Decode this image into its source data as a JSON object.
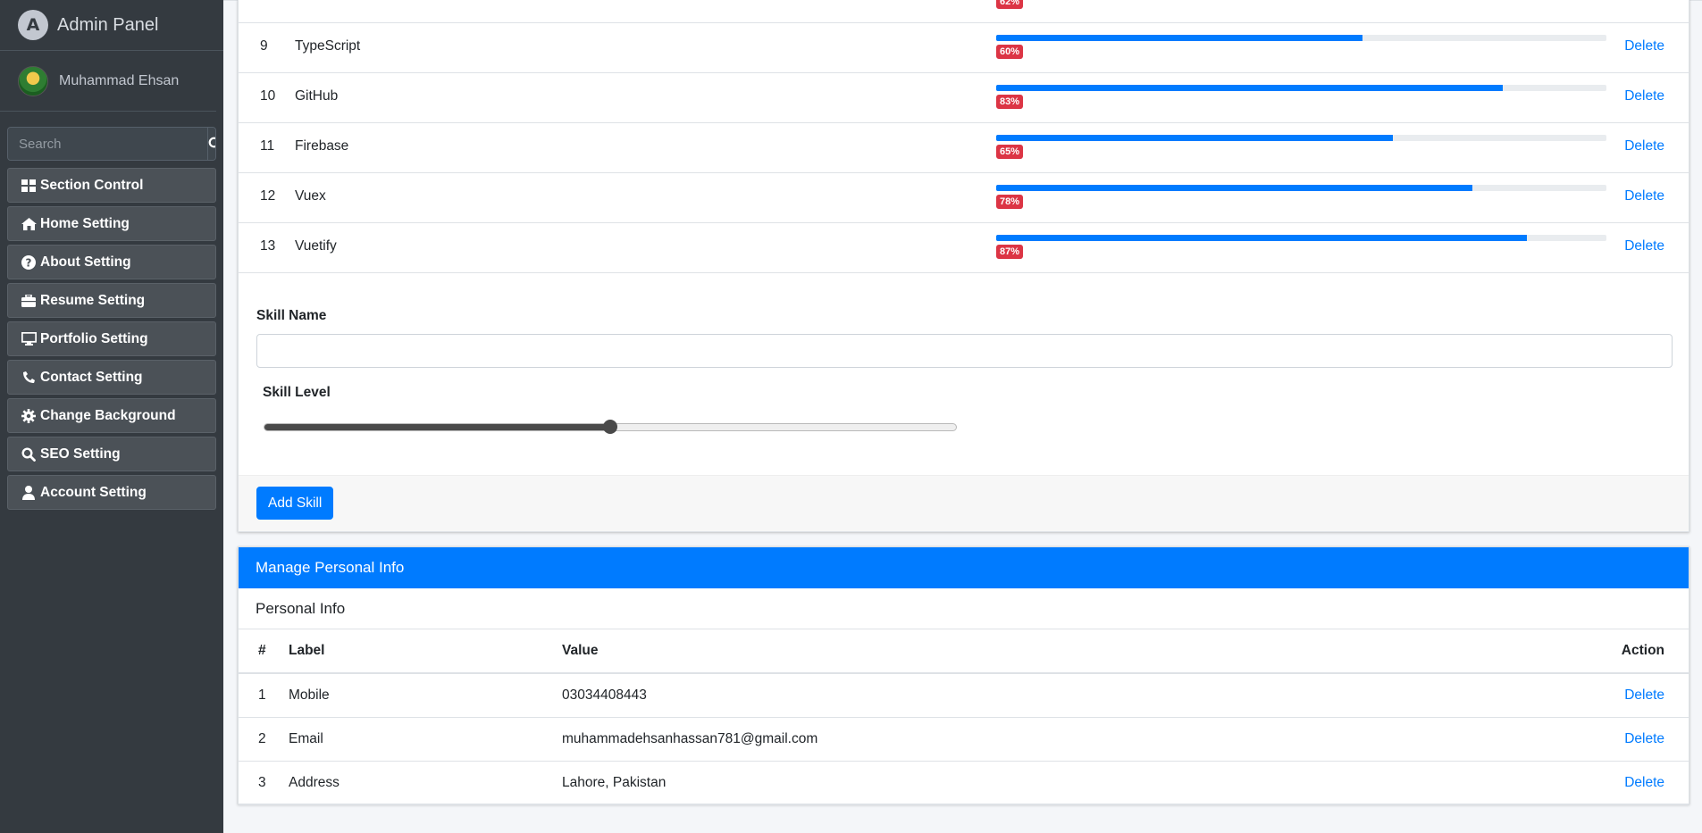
{
  "brand": {
    "title": "Admin Panel",
    "logo_letter": "A"
  },
  "user": {
    "name": "Muhammad Ehsan"
  },
  "search": {
    "placeholder": "Search"
  },
  "sidebar": {
    "items": [
      {
        "label": "Section Control",
        "icon": "th-large-icon"
      },
      {
        "label": "Home Setting",
        "icon": "home-icon"
      },
      {
        "label": "About Setting",
        "icon": "question-circle-icon"
      },
      {
        "label": "Resume Setting",
        "icon": "briefcase-icon"
      },
      {
        "label": "Portfolio Setting",
        "icon": "desktop-icon"
      },
      {
        "label": "Contact Setting",
        "icon": "phone-icon"
      },
      {
        "label": "Change Background",
        "icon": "gear-icon"
      },
      {
        "label": "SEO Setting",
        "icon": "search-icon"
      },
      {
        "label": "Account Setting",
        "icon": "user-icon"
      }
    ]
  },
  "skills": {
    "partial_top_badge": "62%",
    "rows": [
      {
        "num": "9",
        "name": "TypeScript",
        "level": 60,
        "badge": "60%",
        "action": "Delete"
      },
      {
        "num": "10",
        "name": "GitHub",
        "level": 83,
        "badge": "83%",
        "action": "Delete"
      },
      {
        "num": "11",
        "name": "Firebase",
        "level": 65,
        "badge": "65%",
        "action": "Delete"
      },
      {
        "num": "12",
        "name": "Vuex",
        "level": 78,
        "badge": "78%",
        "action": "Delete"
      },
      {
        "num": "13",
        "name": "Vuetify",
        "level": 87,
        "badge": "87%",
        "action": "Delete"
      }
    ]
  },
  "skill_form": {
    "name_label": "Skill Name",
    "name_value": "",
    "level_label": "Skill Level",
    "level_value": 50,
    "submit_label": "Add Skill"
  },
  "personal_info": {
    "header": "Manage Personal Info",
    "subheader": "Personal Info",
    "columns": {
      "num": "#",
      "label": "Label",
      "value": "Value",
      "action": "Action"
    },
    "rows": [
      {
        "num": "1",
        "label": "Mobile",
        "value": "03034408443",
        "action": "Delete"
      },
      {
        "num": "2",
        "label": "Email",
        "value": "muhammadehsanhassan781@gmail.com",
        "action": "Delete"
      },
      {
        "num": "3",
        "label": "Address",
        "value": "Lahore, Pakistan",
        "action": "Delete"
      }
    ]
  },
  "colors": {
    "primary": "#007bff",
    "sidebar_bg": "#343a40",
    "badge_danger": "#dc3545"
  }
}
